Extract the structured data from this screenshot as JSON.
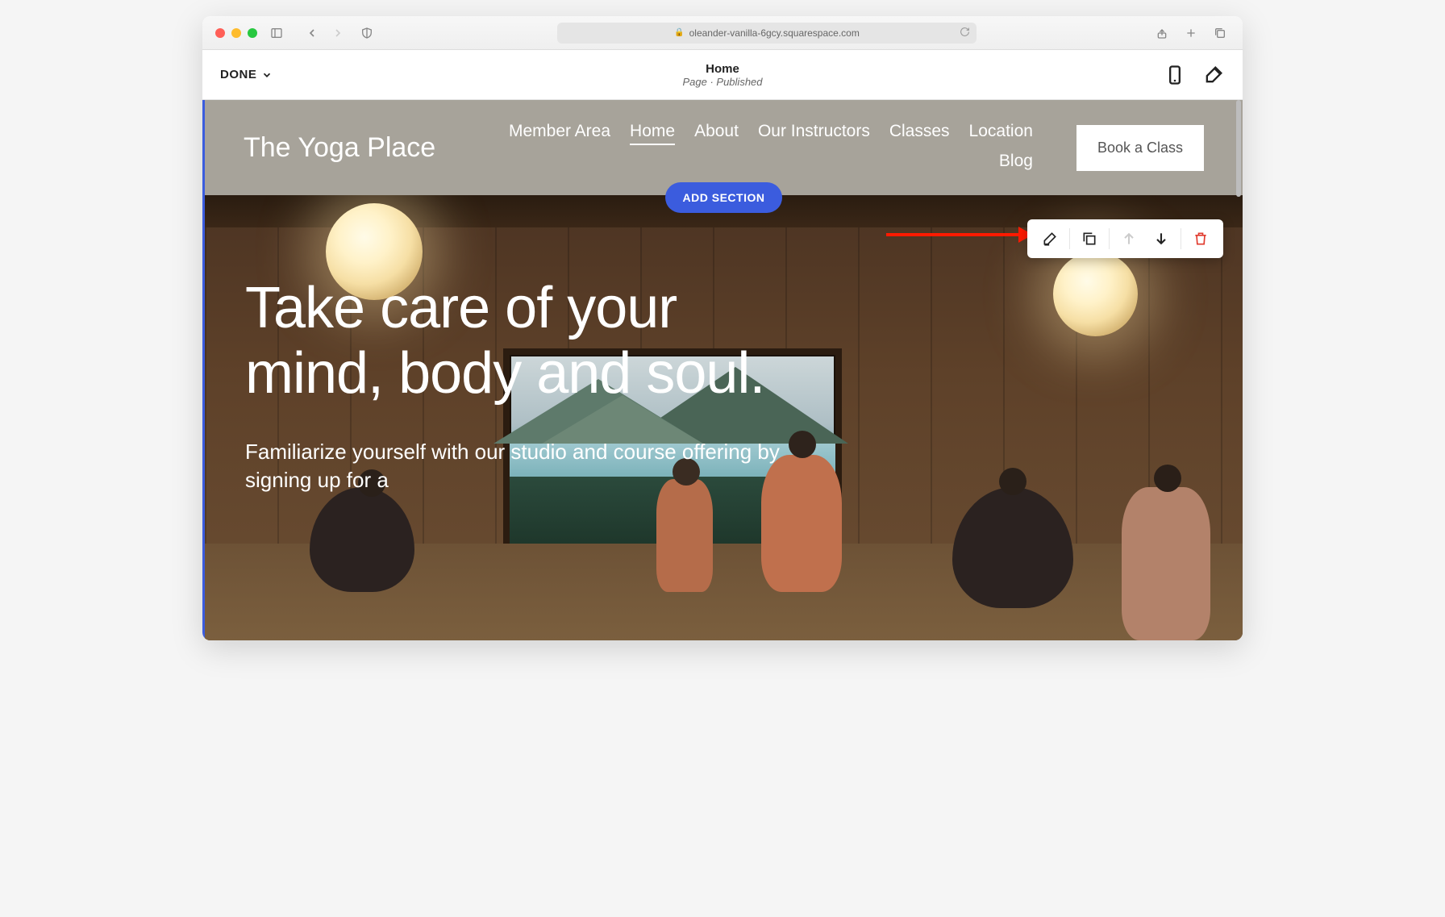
{
  "browser": {
    "url": "oleander-vanilla-6gcy.squarespace.com"
  },
  "editor": {
    "done_label": "DONE",
    "page_title": "Home",
    "page_subtitle": "Page · Published",
    "add_section_label": "ADD SECTION"
  },
  "site": {
    "title": "The Yoga Place",
    "nav": [
      {
        "label": "Member Area",
        "active": false
      },
      {
        "label": "Home",
        "active": true
      },
      {
        "label": "About",
        "active": false
      },
      {
        "label": "Our Instructors",
        "active": false
      },
      {
        "label": "Classes",
        "active": false
      },
      {
        "label": "Location",
        "active": false
      },
      {
        "label": "Blog",
        "active": false
      }
    ],
    "cta_label": "Book a Class",
    "hero": {
      "heading": "Take care of your mind, body and soul.",
      "subheading": "Familiarize yourself with our studio and course offering by signing up for a"
    }
  }
}
